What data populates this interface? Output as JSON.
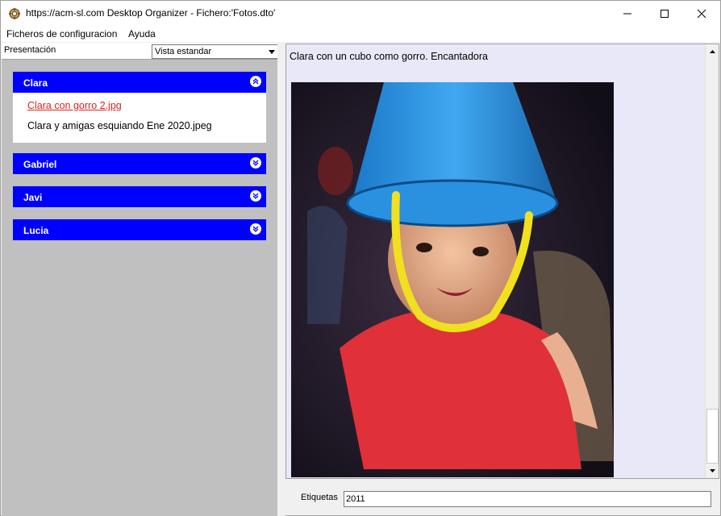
{
  "window": {
    "title": "https://acm-sl.com Desktop Organizer - Fichero:'Fotos.dto'",
    "icon": "app-icon",
    "controls": [
      "minimize-icon",
      "maximize-icon",
      "close-icon"
    ]
  },
  "menu": {
    "items": [
      {
        "label": "Ficheros de configuracion"
      },
      {
        "label": "Ayuda"
      }
    ]
  },
  "presentation": {
    "label": "Presentación",
    "selected": "Vista estandar"
  },
  "groups": [
    {
      "label": "Clara",
      "expanded": true,
      "icon": "chevron-up-double-icon"
    },
    {
      "label": "Gabriel",
      "expanded": false,
      "icon": "chevron-down-double-icon"
    },
    {
      "label": "Javi",
      "expanded": false,
      "icon": "chevron-down-double-icon"
    },
    {
      "label": "Lucia",
      "expanded": false,
      "icon": "chevron-down-double-icon"
    }
  ],
  "files": [
    {
      "label": "Clara con gorro 2.jpg",
      "active": true
    },
    {
      "label": "Clara y amigas esquiando Ene 2020.jpeg",
      "active": false
    }
  ],
  "viewer": {
    "caption": "Clara con un cubo como gorro. Encantadora"
  },
  "tags": {
    "label": "Etiquetas",
    "value": "2011"
  },
  "colors": {
    "group_header": "#0000ff",
    "active_link": "#e02020",
    "viewer_bg": "#e8e8f8",
    "left_bg": "#c0c0c0"
  }
}
